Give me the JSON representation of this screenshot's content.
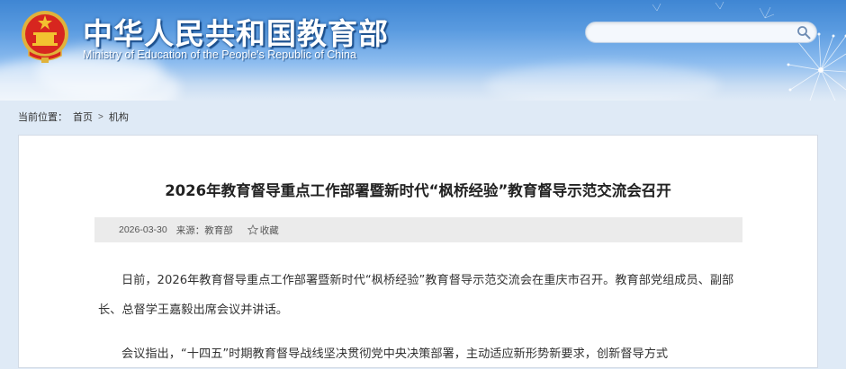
{
  "header": {
    "title": "中华人民共和国教育部",
    "subtitle": "Ministry of Education of the People's Republic of China",
    "emblem_icon": "national-emblem-icon",
    "search": {
      "placeholder": "",
      "icon": "search-icon"
    }
  },
  "breadcrumb": {
    "label": "当前位置：",
    "items": [
      "首页",
      "机构"
    ],
    "separator": ">"
  },
  "article": {
    "title": "2026年教育督导重点工作部署暨新时代“枫桥经验”教育督导示范交流会召开",
    "date": "2026-03-30",
    "source_label": "来源：",
    "source": "教育部",
    "favorite_label": "收藏",
    "favorite_icon": "star-icon",
    "paragraphs": [
      "日前，2026年教育督导重点工作部署暨新时代“枫桥经验”教育督导示范交流会在重庆市召开。教育部党组成员、副部长、总督学王嘉毅出席会议并讲话。",
      "会议指出，“十四五”时期教育督导战线坚决贯彻党中央决策部署，主动适应新形势新要求，创新督导方式"
    ]
  },
  "colors": {
    "header_blue": "#3f86d3",
    "page_bg": "#dfeaf6",
    "meta_bar": "#ebebeb",
    "emblem_red": "#d7261f",
    "emblem_gold": "#f2c230"
  }
}
